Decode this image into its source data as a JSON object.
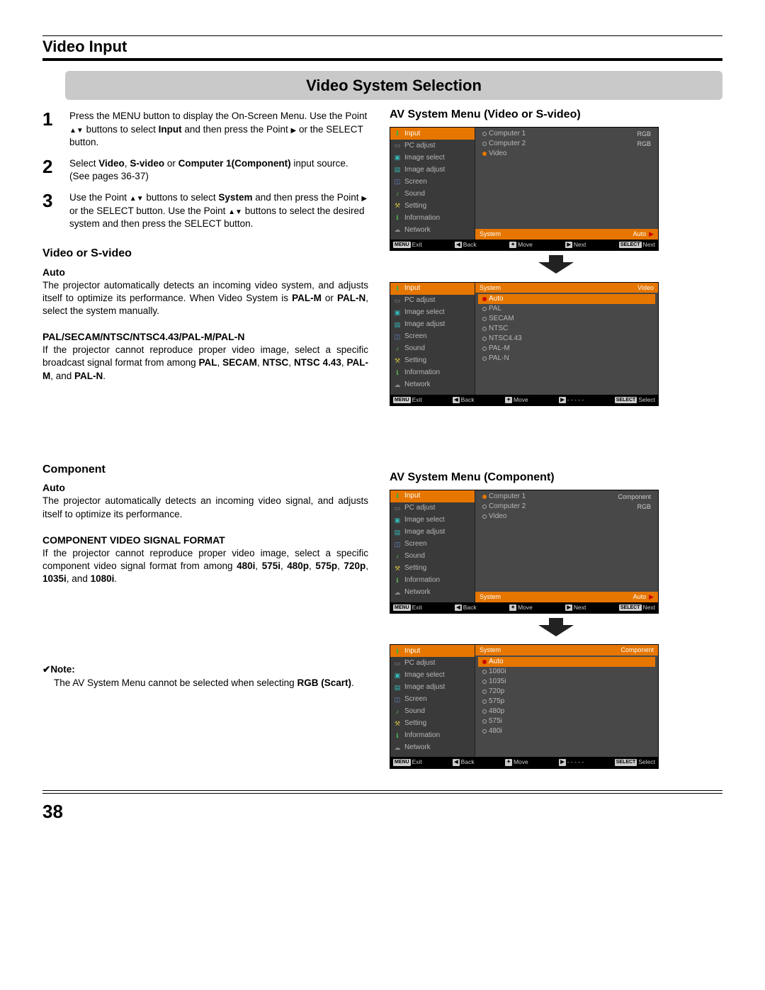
{
  "header": {
    "section": "Video Input",
    "banner": "Video System Selection"
  },
  "steps": {
    "s1": {
      "num": "1",
      "p1": "Press the MENU button to display the On-Screen Menu. Use the Point ",
      "p2": " buttons to select ",
      "b1": "Input",
      "p3": " and then press the Point ",
      "p4": " or the SELECT button."
    },
    "s2": {
      "num": "2",
      "p1": "Select ",
      "b1": "Video",
      "c1": ", ",
      "b2": "S-video",
      "c2": " or ",
      "b3": "Computer 1(Component)",
      "p2": " input source. (See pages 36-37)"
    },
    "s3": {
      "num": "3",
      "p1": "Use the Point ",
      "p2": " buttons to select ",
      "b1": "System",
      "p3": " and then press the Point ",
      "p4": " or the SELECT button. Use the Point ",
      "p5": " buttons to select the desired system and then press the SELECT button."
    }
  },
  "vs": {
    "h": "Video or S-video",
    "auto_h": "Auto",
    "auto_t1": "The projector automatically detects an incoming video system, and adjusts itself to optimize its performance. When Video System is ",
    "auto_b1": "PAL-M",
    "auto_or": " or ",
    "auto_b2": "PAL-N",
    "auto_t2": ", select the system manually.",
    "pal_h": "PAL/SECAM/NTSC/NTSC4.43/PAL-M/PAL-N",
    "pal_t1": "If the projector cannot reproduce proper video image, select a specific broadcast signal format from among ",
    "pal_b1": "PAL",
    "pal_c1": ", ",
    "pal_b2": "SECAM",
    "pal_c2": ", ",
    "pal_b3": "NTSC",
    "pal_c3": ", ",
    "pal_b4": "NTSC 4.43",
    "pal_c4": ", ",
    "pal_b5": "PAL-M",
    "pal_c5": ", and ",
    "pal_b6": "PAL-N",
    "pal_c6": "."
  },
  "comp": {
    "h": "Component",
    "auto_h": "Auto",
    "auto_t": "The projector automatically detects an incoming video signal, and adjusts itself to optimize its performance.",
    "fmt_h": "COMPONENT VIDEO SIGNAL FORMAT",
    "fmt_t1": "If the projector cannot reproduce proper video image, select a specific component video signal format from among ",
    "fmt_b1": "480i",
    "fmt_c1": ", ",
    "fmt_b2": "575i",
    "fmt_c2": ", ",
    "fmt_b3": "480p",
    "fmt_c3": ", ",
    "fmt_b4": "575p",
    "fmt_c4": ", ",
    "fmt_b5": "720p",
    "fmt_c5": ", ",
    "fmt_b6": "1035i",
    "fmt_c6": ", and ",
    "fmt_b7": "1080i",
    "fmt_c7": "."
  },
  "note": {
    "chk": "✔",
    "h": "Note:",
    "t1": "The AV System Menu cannot be selected when selecting ",
    "b1": "RGB (Scart)",
    "t2": "."
  },
  "sidebar_items": [
    {
      "label": "Input",
      "icon": "⬇",
      "cls": "ic-green"
    },
    {
      "label": "PC adjust",
      "icon": "▭",
      "cls": "ic-gray"
    },
    {
      "label": "Image select",
      "icon": "▣",
      "cls": "ic-teal"
    },
    {
      "label": "Image adjust",
      "icon": "▤",
      "cls": "ic-teal"
    },
    {
      "label": "Screen",
      "icon": "◫",
      "cls": "ic-blue"
    },
    {
      "label": "Sound",
      "icon": "♪",
      "cls": "ic-grn2"
    },
    {
      "label": "Setting",
      "icon": "⚒",
      "cls": "ic-yel"
    },
    {
      "label": "Information",
      "icon": "ℹ",
      "cls": "ic-grn2"
    },
    {
      "label": "Network",
      "icon": "☁",
      "cls": "ic-gray"
    }
  ],
  "osd1": {
    "title": "AV System Menu (Video or S-video)",
    "top": {
      "opts": [
        {
          "label": "Computer 1",
          "val": "RGB",
          "sel": false
        },
        {
          "label": "Computer 2",
          "val": "RGB",
          "sel": false
        },
        {
          "label": "Video",
          "val": "",
          "sel": true
        }
      ],
      "sys": "System",
      "sysv": "Auto",
      "bottom": [
        "Exit",
        "Back",
        "Move",
        "Next",
        "Next"
      ]
    },
    "bot": {
      "hdr1": "System",
      "hdr2": "Video",
      "opts": [
        {
          "label": "Auto",
          "sel": true
        },
        {
          "label": "PAL",
          "sel": false
        },
        {
          "label": "SECAM",
          "sel": false
        },
        {
          "label": "NTSC",
          "sel": false
        },
        {
          "label": "NTSC4.43",
          "sel": false
        },
        {
          "label": "PAL-M",
          "sel": false
        },
        {
          "label": "PAL-N",
          "sel": false
        }
      ],
      "bottom": [
        "Exit",
        "Back",
        "Move",
        "- - - - -",
        "Select"
      ]
    }
  },
  "osd2": {
    "title": "AV System Menu (Component)",
    "top": {
      "opts": [
        {
          "label": "Computer 1",
          "val": "Component",
          "sel": true
        },
        {
          "label": "Computer 2",
          "val": "RGB",
          "sel": false
        },
        {
          "label": "Video",
          "val": "",
          "sel": false
        }
      ],
      "sys": "System",
      "sysv": "Auto",
      "bottom": [
        "Exit",
        "Back",
        "Move",
        "Next",
        "Next"
      ]
    },
    "bot": {
      "hdr1": "System",
      "hdr2": "Component",
      "opts": [
        {
          "label": "Auto",
          "sel": true
        },
        {
          "label": "1080i",
          "sel": false
        },
        {
          "label": "1035i",
          "sel": false
        },
        {
          "label": "720p",
          "sel": false
        },
        {
          "label": "575p",
          "sel": false
        },
        {
          "label": "480p",
          "sel": false
        },
        {
          "label": "575i",
          "sel": false
        },
        {
          "label": "480i",
          "sel": false
        }
      ],
      "bottom": [
        "Exit",
        "Back",
        "Move",
        "- - - - -",
        "Select"
      ]
    }
  },
  "kbd": {
    "menu": "MENU",
    "select": "SELECT"
  },
  "page": "38"
}
